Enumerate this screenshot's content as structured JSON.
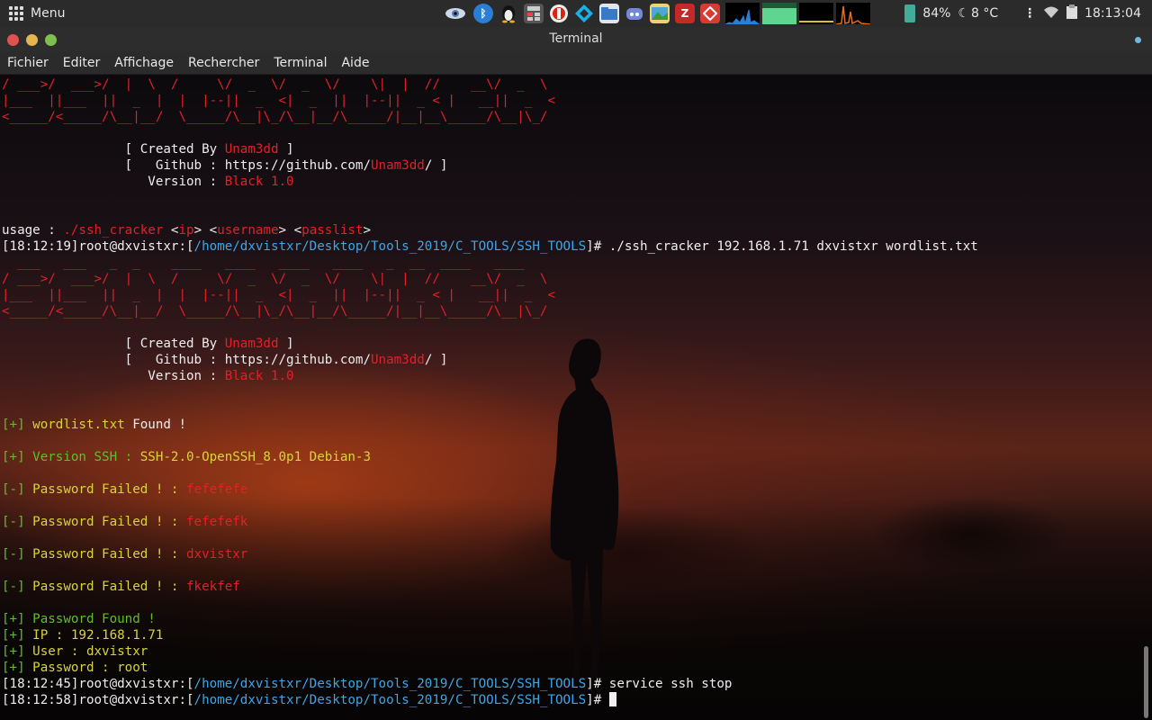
{
  "panel": {
    "menu_label": "Menu",
    "battery": "84%",
    "weather": "8 °C",
    "clock": "18:13:04",
    "tray_icons": [
      "eye-icon",
      "bluetooth-icon",
      "linux-penguin-icon",
      "calculator-icon",
      "record-icon",
      "kodi-icon",
      "files-icon",
      "discord-icon",
      "image-viewer-icon",
      "filezilla-icon",
      "anydesk-icon",
      "cpu-monitor",
      "mem-monitor",
      "net-monitor",
      "disk-monitor"
    ]
  },
  "window": {
    "title": "Terminal",
    "buttons": {
      "close_color": "#e0524f",
      "min_color": "#e4b64d",
      "max_color": "#7fbf4f"
    }
  },
  "menubar": [
    "Fichier",
    "Editer",
    "Affichage",
    "Rechercher",
    "Terminal",
    "Aide"
  ],
  "colors": {
    "accent_red": "#e0212a",
    "green": "#5fbf2a",
    "yellow": "#d8d43a",
    "path": "#3fa5e6"
  },
  "terminal": {
    "banner_art": [
      "/ ___>/  ___>/  |  \\  /     \\/  _  \\/  _  \\/    \\|  |  //    __\\/  _  \\",
      "|___  ||___  ||  _  |  |  |--||  _  <|  _  ||  |--||  _ < |   __||  _  <",
      "<_____/<_____/\\__|__/  \\_____/\\__|\\_/\\__|__/\\_____/|__|__\\_____/\\__|\\_/"
    ],
    "banner_top": "  ___   ___   _  _    ____   ____   ____   ____   _  __  ____   ____  ",
    "credits": {
      "created_prefix": "[ Created By ",
      "author": "Unam3dd",
      "created_suffix": " ]",
      "github_prefix": "[   Github : https://github.com/",
      "github_suffix": "/ ]",
      "version_prefix": "Version : ",
      "version": "Black 1.0"
    },
    "usage_prefix": "usage : ",
    "usage_cmd": "./ssh_cracker",
    "usage_lt1": " <",
    "usage_arg1": "ip",
    "usage_mid1": "> <",
    "usage_arg2": "username",
    "usage_mid2": "> <",
    "usage_arg3": "passlist",
    "usage_end": ">",
    "prompt_user": "root@dxvistxr:[",
    "path": "/home/dxvistxr/Desktop/Tools_2019/C_TOOLS/SSH_TOOLS",
    "prompt_end": "]# ",
    "time1": "[18:12:19]",
    "cmd1": "./ssh_cracker 192.168.1.71 dxvistxr wordlist.txt",
    "plus": "[+]",
    "minus": "[-]",
    "found_file": " wordlist.txt",
    "found_word": " Found !",
    "version_ssh_label": " Version SSH : ",
    "version_ssh": "SSH-2.0-OpenSSH_8.0p1 Debian-3",
    "fail_label": " Password Failed ! : ",
    "fails": [
      "fefefefe",
      "fefefefk",
      "dxvistxr",
      "fkekfef"
    ],
    "pw_found": " Password Found !",
    "ip_line": " IP : 192.168.1.71",
    "user_line": " User : dxvistxr",
    "pass_line": " Password : root",
    "time2": "[18:12:45]",
    "cmd2": "service ssh stop",
    "time3": "[18:12:58]"
  }
}
